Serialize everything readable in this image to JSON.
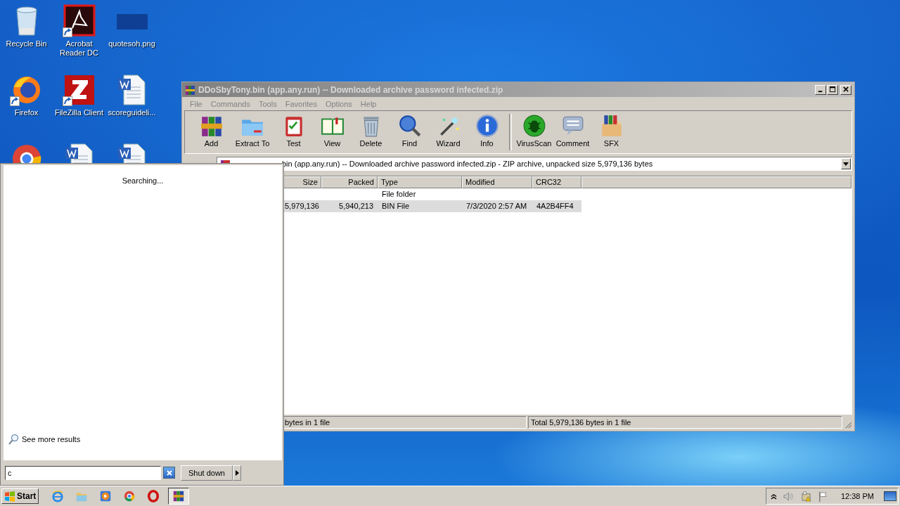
{
  "desktop_icons": [
    {
      "kind": "recycle",
      "label": "Recycle Bin"
    },
    {
      "kind": "acrobat",
      "label": "Acrobat Reader DC",
      "shortcut": true
    },
    {
      "kind": "image",
      "label": "quotesoh.png"
    },
    {
      "kind": "firefox",
      "label": "Firefox",
      "shortcut": true
    },
    {
      "kind": "filezilla",
      "label": "FileZilla Client",
      "shortcut": true
    },
    {
      "kind": "word",
      "label": "scoreguideli..."
    },
    {
      "kind": "chrome"
    },
    {
      "kind": "word"
    },
    {
      "kind": "word"
    }
  ],
  "window": {
    "title": "DDoSbyTony.bin (app.any.run) -- Downloaded archive password infected.zip",
    "menu": [
      "File",
      "Commands",
      "Tools",
      "Favorites",
      "Options",
      "Help"
    ],
    "toolbar": [
      {
        "kind": "add",
        "label": "Add"
      },
      {
        "kind": "extract",
        "label": "Extract To"
      },
      {
        "kind": "test",
        "label": "Test"
      },
      {
        "kind": "view",
        "label": "View"
      },
      {
        "kind": "delete",
        "label": "Delete"
      },
      {
        "kind": "find",
        "label": "Find"
      },
      {
        "kind": "wizard",
        "label": "Wizard"
      },
      {
        "kind": "info",
        "label": "Info"
      },
      {
        "kind": "virusscan",
        "label": "VirusScan"
      },
      {
        "kind": "comment",
        "label": "Comment"
      },
      {
        "kind": "sfx",
        "label": "SFX"
      }
    ],
    "address": "bin (app.any.run) -- Downloaded archive password infected.zip - ZIP archive, unpacked size 5,979,136 bytes",
    "columns": [
      "Size",
      "Packed",
      "Type",
      "Modified",
      "CRC32"
    ],
    "rows": [
      {
        "type": "File folder",
        "selected": false
      },
      {
        "size": "5,979,136",
        "packed": "5,940,213",
        "type": "BIN File",
        "modified": "7/3/2020 2:57 AM",
        "crc32": "4A2B4FF4",
        "selected": true
      }
    ],
    "status_left": "bytes in 1 file",
    "status_right": "Total 5,979,136 bytes in 1 file"
  },
  "start_menu": {
    "status": "Searching...",
    "more_results": "See more results",
    "search_value": "c",
    "shutdown": "Shut down"
  },
  "taskbar": {
    "start": "Start",
    "apps": [
      {
        "kind": "ie",
        "active": false
      },
      {
        "kind": "explorer",
        "active": false
      },
      {
        "kind": "media",
        "active": false
      },
      {
        "kind": "chrome",
        "active": false
      },
      {
        "kind": "opera",
        "active": false
      },
      {
        "kind": "winrar",
        "active": true
      }
    ],
    "time": "12:38 PM"
  }
}
